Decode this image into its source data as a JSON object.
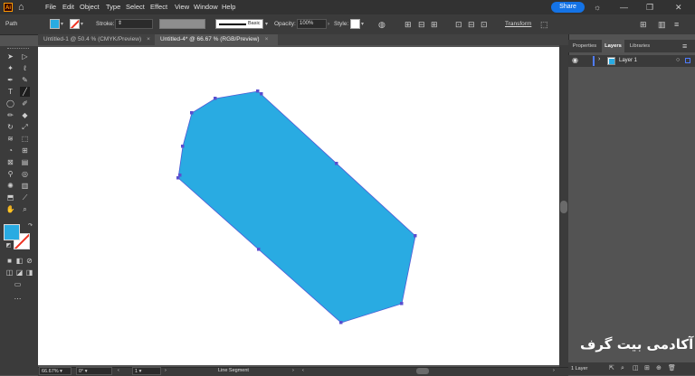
{
  "app": {
    "logo": "Ai",
    "home_icon": "home-icon"
  },
  "menu": [
    "File",
    "Edit",
    "Object",
    "Type",
    "Select",
    "Effect",
    "View",
    "Window",
    "Help"
  ],
  "share_label": "Share",
  "control": {
    "selection_type": "Path",
    "fill_color": "#29abe2",
    "stroke_label": "Stroke:",
    "brush_label": "Basic",
    "opacity_label": "Opacity:",
    "opacity_value": "100%",
    "style_label": "Style:",
    "transform_label": "Transform"
  },
  "tabs": [
    {
      "label": "Untitled-1 @ 50.4 % (CMYK/Preview)",
      "active": false
    },
    {
      "label": "Untitled-4* @ 66.67 % (RGB/Preview)",
      "active": true
    }
  ],
  "shape": {
    "fill": "#29abe2",
    "anchor_color": "#5a4fcf"
  },
  "status": {
    "zoom": "66.67%",
    "rotation": "0°",
    "artboard": "1",
    "tool": "Line Segment"
  },
  "panel": {
    "tabs": [
      "Properties",
      "Layers",
      "Libraries"
    ],
    "active_tab": "Layers",
    "layer_name": "Layer 1",
    "layer_color": "#4f7cff",
    "footer_count": "1 Layer"
  },
  "watermark_text": "آکادمی بیت گرف"
}
